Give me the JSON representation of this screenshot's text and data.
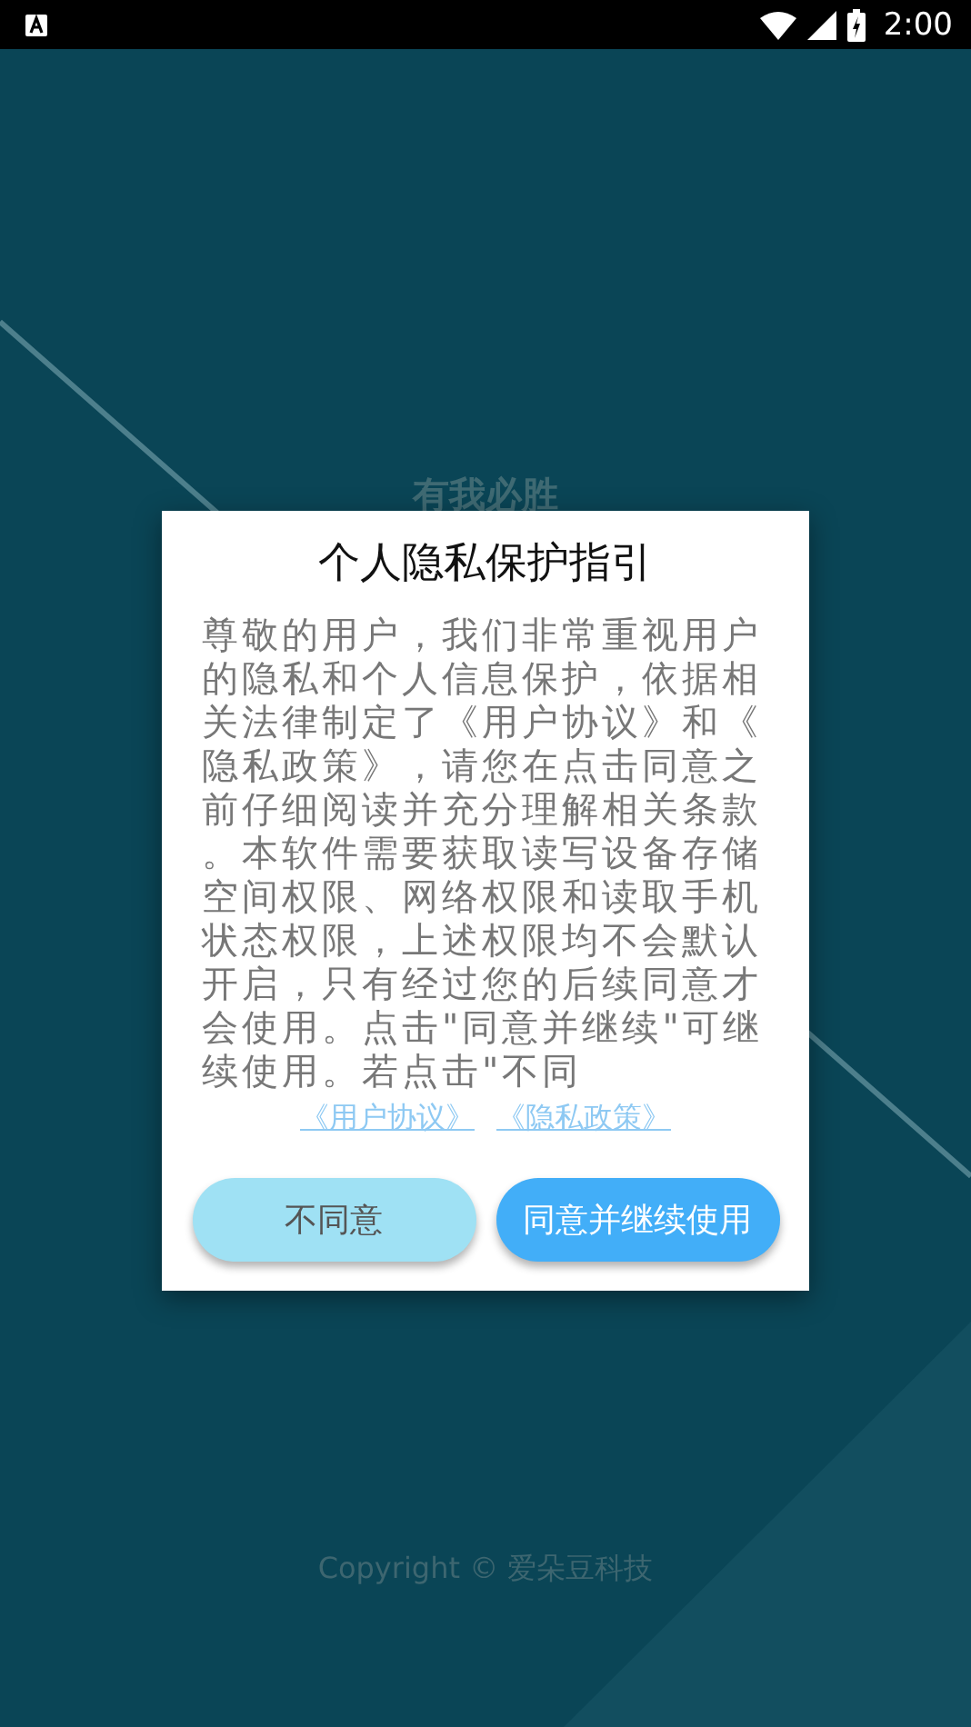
{
  "status_bar": {
    "time": "2:00"
  },
  "app_title": "有我必胜",
  "dialog": {
    "title": "个人隐私保护指引",
    "body": "尊敬的用户，我们非常重视用户的隐私和个人信息保护，依据相关法律制定了《用户协议》和《隐私政策》，请您在点击同意之前仔细阅读并充分理解相关条款。本软件需要获取读写设备存储空间权限、网络权限和读取手机状态权限，上述权限均不会默认开启，只有经过您的后续同意才会使用。点击\"同意并继续\"可继续使用。若点击\"不同",
    "links": [
      "《用户协议》",
      "《隐私政策》"
    ],
    "buttons": [
      {
        "label": "不同意",
        "kind": "secondary"
      },
      {
        "label": "同意并继续使用",
        "kind": "primary"
      }
    ]
  },
  "copyright": "Copyright © 爱朵豆科技"
}
